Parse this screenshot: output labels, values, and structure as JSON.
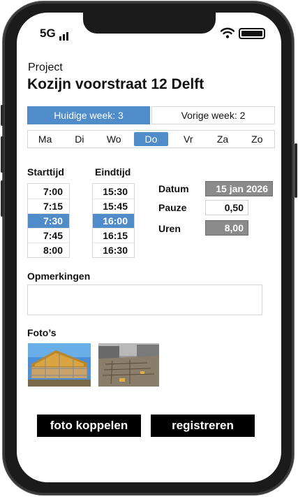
{
  "status_bar": {
    "carrier": "5G"
  },
  "project": {
    "label": "Project",
    "name": "Kozijn voorstraat 12 Delft"
  },
  "weeks": {
    "current_label": "Huidige week: 3",
    "previous_label": "Vorige week: 2"
  },
  "days": [
    "Ma",
    "Di",
    "Wo",
    "Do",
    "Vr",
    "Za",
    "Zo"
  ],
  "selected_day": "Do",
  "start_time": {
    "label": "Starttijd",
    "options": [
      "7:00",
      "7:15",
      "7:30",
      "7:45",
      "8:00"
    ],
    "selected": "7:30"
  },
  "end_time": {
    "label": "Eindtijd",
    "options": [
      "15:30",
      "15:45",
      "16:00",
      "16:15",
      "16:30"
    ],
    "selected": "16:00"
  },
  "details": {
    "date_label": "Datum",
    "date_value": "15 jan 2026",
    "break_label": "Pauze",
    "break_value": "0,50",
    "hours_label": "Uren",
    "hours_value": "8,00"
  },
  "remarks": {
    "label": "Opmerkingen",
    "value": ""
  },
  "photos": {
    "label": "Foto’s"
  },
  "actions": {
    "link_photo": "foto koppelen",
    "register": "registreren"
  },
  "colors": {
    "accent": "#4f8cc9",
    "frame": "#1b1b1b",
    "grey_field": "#8a8a8a"
  }
}
